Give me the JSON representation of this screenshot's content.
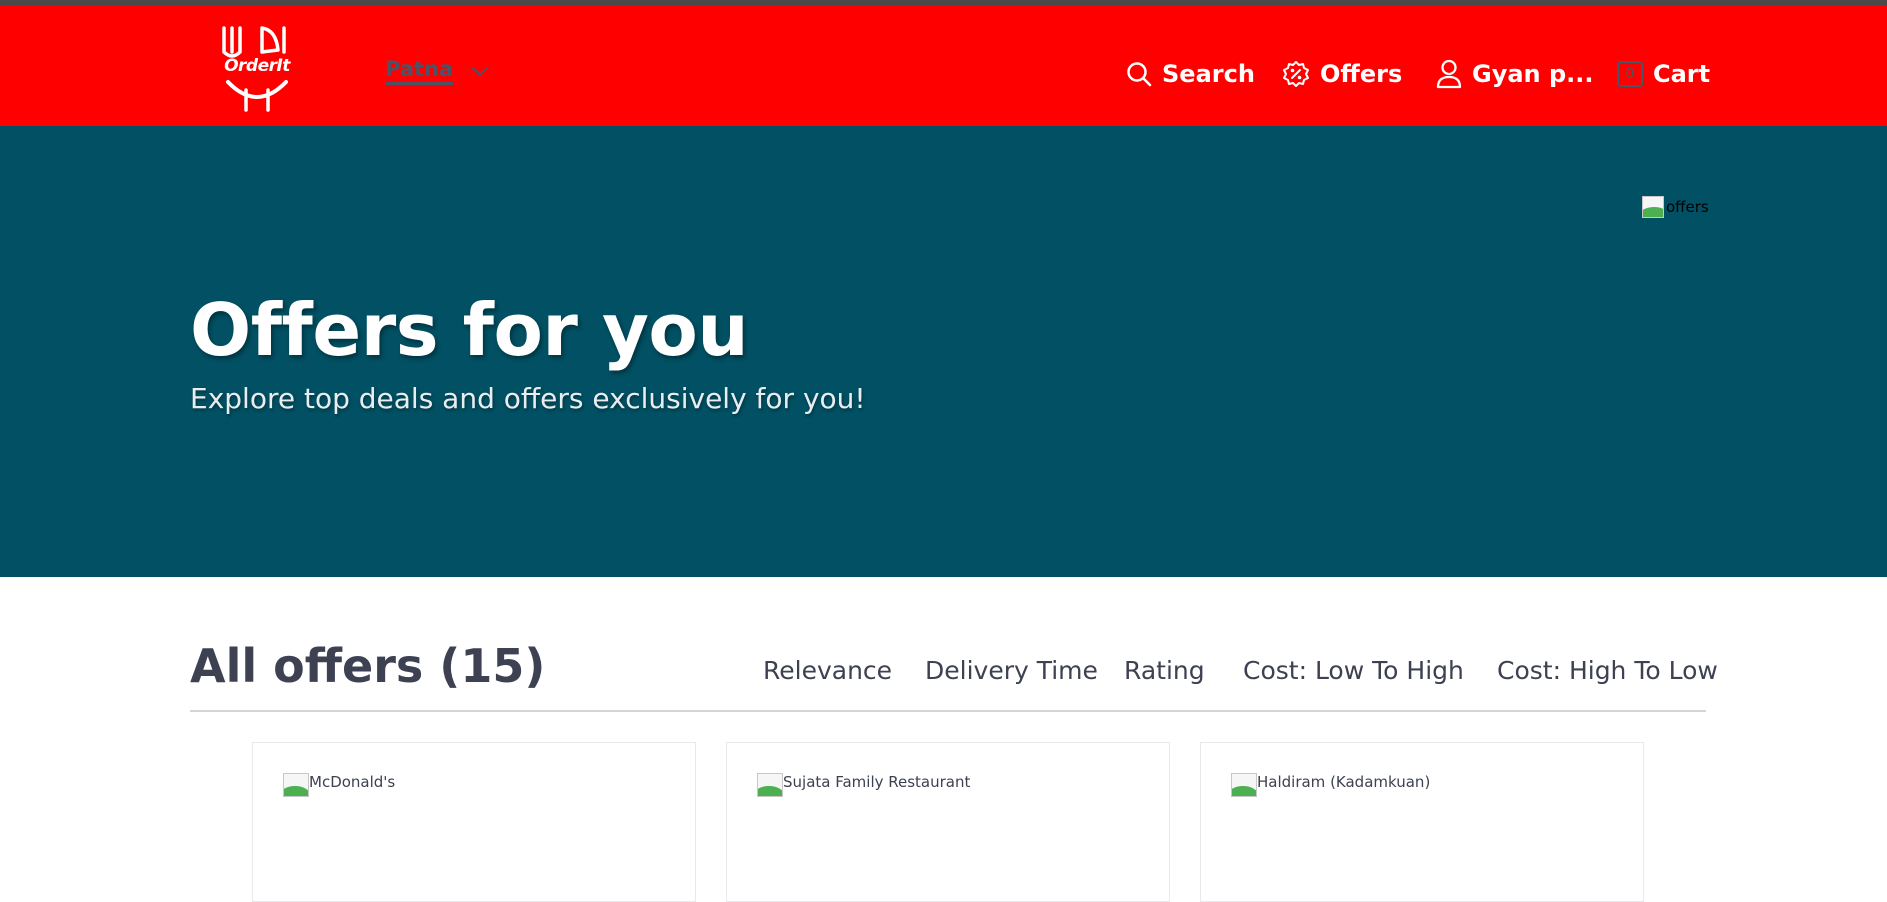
{
  "header": {
    "logo_text": "OrderIt",
    "location": "Patna",
    "nav": {
      "search": "Search",
      "offers": "Offers",
      "user": "Gyan p...",
      "cart": "Cart",
      "cart_count": "0"
    }
  },
  "hero": {
    "image_alt": "offers",
    "title": "Offers for you",
    "subtitle": "Explore top deals and offers exclusively for you!"
  },
  "offers": {
    "heading": "All offers (15)",
    "sort_tabs": [
      {
        "label": "Relevance",
        "active": true
      },
      {
        "label": "Delivery Time",
        "active": false
      },
      {
        "label": "Rating",
        "active": false
      },
      {
        "label": "Cost: Low To High",
        "active": false
      },
      {
        "label": "Cost: High To Low",
        "active": false
      }
    ],
    "cards": [
      {
        "image_alt": "McDonald's"
      },
      {
        "image_alt": "Sujata Family Restaurant"
      },
      {
        "image_alt": "Haldiram (Kadamkuan)"
      }
    ]
  },
  "colors": {
    "header_bg": "#ff0000",
    "hero_bg": "#025063",
    "text_dark": "#3d4152"
  }
}
